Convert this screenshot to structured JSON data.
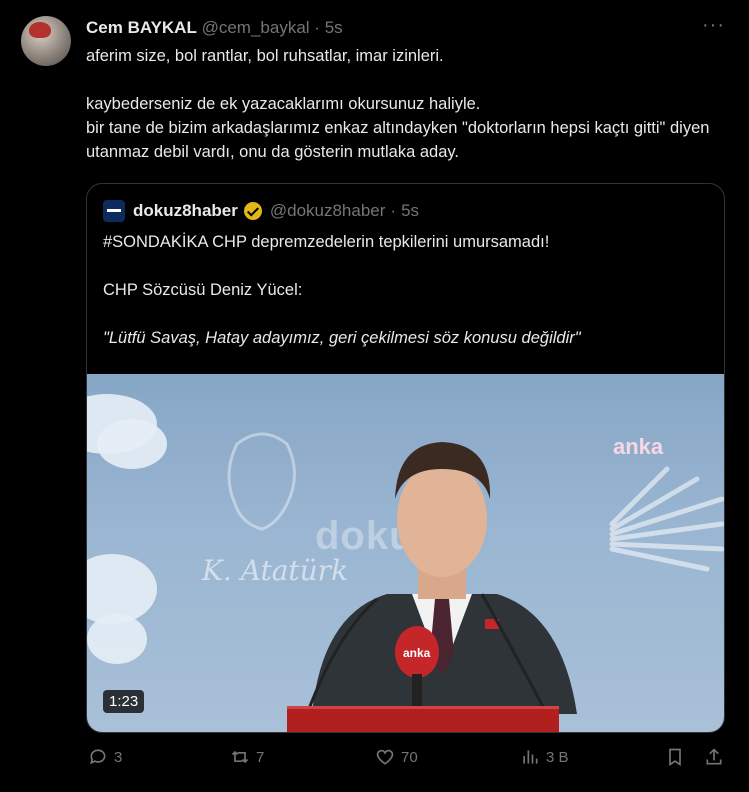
{
  "tweet": {
    "author_name": "Cem BAYKAL",
    "author_handle": "@cem_baykal",
    "separator": "·",
    "time": "5s",
    "more_label": "···",
    "lines": [
      "aferim size, bol rantlar, bol ruhsatlar, imar izinleri.",
      "kaybederseniz de ek yazacaklarımı okursunuz haliyle.",
      "bir tane de bizim arkadaşlarımız enkaz altındayken \"doktorların hepsi kaçtı gitti\" diyen utanmaz debil vardı, onu da gösterin mutlaka aday."
    ]
  },
  "quote": {
    "author_name": "dokuz8haber",
    "author_handle": "@dokuz8haber",
    "separator": "·",
    "time": "5s",
    "lines": [
      "#SONDAKİKA CHP depremzedelerin tepkilerini umursamadı!",
      "CHP Sözcüsü Deniz Yücel:",
      "\"Lütfü Savaş, Hatay adayımız, geri çekilmesi söz konusu değildir\""
    ],
    "video": {
      "duration": "1:23",
      "watermark": "dokuz8",
      "channel_logo": "anka",
      "signature": "K. Atatürk",
      "mic_logo": "anka"
    }
  },
  "actions": {
    "reply_count": "3",
    "retweet_count": "7",
    "like_count": "70",
    "views_count": "3 B"
  },
  "icons": {
    "reply": "reply-icon",
    "retweet": "retweet-icon",
    "like": "heart-icon",
    "views": "views-icon",
    "bookmark": "bookmark-icon",
    "share": "share-icon"
  },
  "colors": {
    "background": "#000000",
    "text": "#e7e9ea",
    "muted": "#71767b",
    "verified": "#e2b719",
    "border": "#2f3336"
  }
}
